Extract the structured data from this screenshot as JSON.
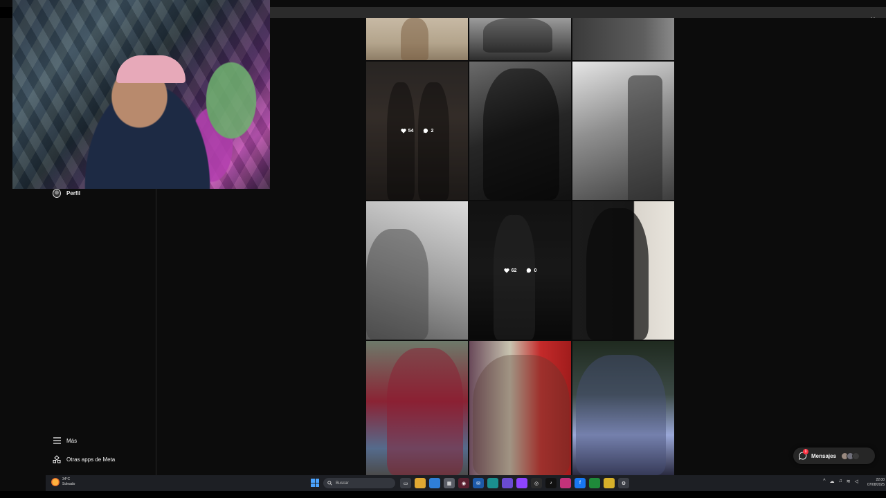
{
  "window": {
    "controls": [
      "···",
      "–",
      "▫",
      "✕"
    ]
  },
  "sidebar": {
    "profile_label": "Perfil",
    "more_label": "Más",
    "meta_apps_label": "Otras apps de Meta"
  },
  "posts": [
    {
      "id": "p00"
    },
    {
      "id": "p01"
    },
    {
      "id": "p02"
    },
    {
      "id": "p10",
      "likes": "54",
      "comments": "2"
    },
    {
      "id": "p11"
    },
    {
      "id": "p12"
    },
    {
      "id": "p20"
    },
    {
      "id": "p21",
      "likes": "62",
      "comments": "0"
    },
    {
      "id": "p22"
    },
    {
      "id": "p30"
    },
    {
      "id": "p31"
    },
    {
      "id": "p32"
    }
  ],
  "messages": {
    "label": "Mensajes",
    "badge": "1"
  },
  "taskbar": {
    "weather_temp": "34°C",
    "weather_desc": "Soleado",
    "search_placeholder": "Buscar",
    "time": "22:00",
    "date": "07/08/2025"
  },
  "colors": {
    "accent": "#ff3040",
    "taskbar_bg": "#1d1f24",
    "page_bg": "#0c0c0c"
  }
}
